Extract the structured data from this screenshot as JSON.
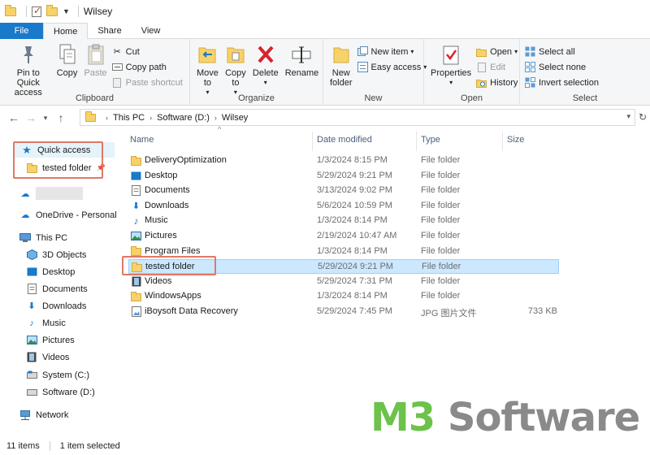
{
  "window": {
    "title": "Wilsey"
  },
  "ribbon_tabs": [
    "File",
    "Home",
    "Share",
    "View"
  ],
  "ribbon": {
    "clipboard": {
      "label": "Clipboard",
      "pin": "Pin to Quick access",
      "copy": "Copy",
      "paste": "Paste",
      "cut": "Cut",
      "copy_path": "Copy path",
      "paste_shortcut": "Paste shortcut"
    },
    "organize": {
      "label": "Organize",
      "move_to": "Move to",
      "copy_to": "Copy to",
      "delete": "Delete",
      "rename": "Rename"
    },
    "new": {
      "label": "New",
      "new_folder": "New folder",
      "new_item": "New item",
      "easy_access": "Easy access"
    },
    "open": {
      "label": "Open",
      "properties": "Properties",
      "open": "Open",
      "edit": "Edit",
      "history": "History"
    },
    "select": {
      "label": "Select",
      "select_all": "Select all",
      "select_none": "Select none",
      "invert": "Invert selection"
    }
  },
  "address": {
    "crumbs": [
      "This PC",
      "Software (D:)",
      "Wilsey"
    ]
  },
  "nav": {
    "quick_access": "Quick access",
    "quick_item": "tested folder",
    "onedrive": "OneDrive - Personal",
    "this_pc": "This PC",
    "pc_items": [
      "3D Objects",
      "Desktop",
      "Documents",
      "Downloads",
      "Music",
      "Pictures",
      "Videos",
      "System (C:)",
      "Software (D:)"
    ],
    "network": "Network"
  },
  "columns": {
    "name": "Name",
    "date": "Date modified",
    "type": "Type",
    "size": "Size"
  },
  "files": [
    {
      "name": "DeliveryOptimization",
      "date": "1/3/2024 8:15 PM",
      "type": "File folder",
      "size": "",
      "icon": "folder-icon"
    },
    {
      "name": "Desktop",
      "date": "5/29/2024 9:21 PM",
      "type": "File folder",
      "size": "",
      "icon": "desktop-icon"
    },
    {
      "name": "Documents",
      "date": "3/13/2024 9:02 PM",
      "type": "File folder",
      "size": "",
      "icon": "documents-icon"
    },
    {
      "name": "Downloads",
      "date": "5/6/2024 10:59 PM",
      "type": "File folder",
      "size": "",
      "icon": "downloads-icon"
    },
    {
      "name": "Music",
      "date": "1/3/2024 8:14 PM",
      "type": "File folder",
      "size": "",
      "icon": "music-icon"
    },
    {
      "name": "Pictures",
      "date": "2/19/2024 10:47 AM",
      "type": "File folder",
      "size": "",
      "icon": "pictures-icon"
    },
    {
      "name": "Program Files",
      "date": "1/3/2024 8:14 PM",
      "type": "File folder",
      "size": "",
      "icon": "folder-icon"
    },
    {
      "name": "tested folder",
      "date": "5/29/2024 9:21 PM",
      "type": "File folder",
      "size": "",
      "icon": "folder-icon",
      "selected": true
    },
    {
      "name": "Videos",
      "date": "5/29/2024 7:31 PM",
      "type": "File folder",
      "size": "",
      "icon": "videos-icon"
    },
    {
      "name": "WindowsApps",
      "date": "1/3/2024 8:14 PM",
      "type": "File folder",
      "size": "",
      "icon": "folder-icon"
    },
    {
      "name": "iBoysoft Data Recovery",
      "date": "5/29/2024 7:45 PM",
      "type": "JPG 图片文件",
      "size": "733 KB",
      "icon": "image-file-icon"
    }
  ],
  "status": {
    "count": "11 items",
    "selected": "1 item selected"
  },
  "watermark": {
    "part1": "M3",
    "part2": " Software"
  },
  "colors": {
    "accent": "#1979ca",
    "selection": "#cce8ff",
    "highlight_box": "#e07866",
    "watermark_green": "#6cc24a"
  }
}
